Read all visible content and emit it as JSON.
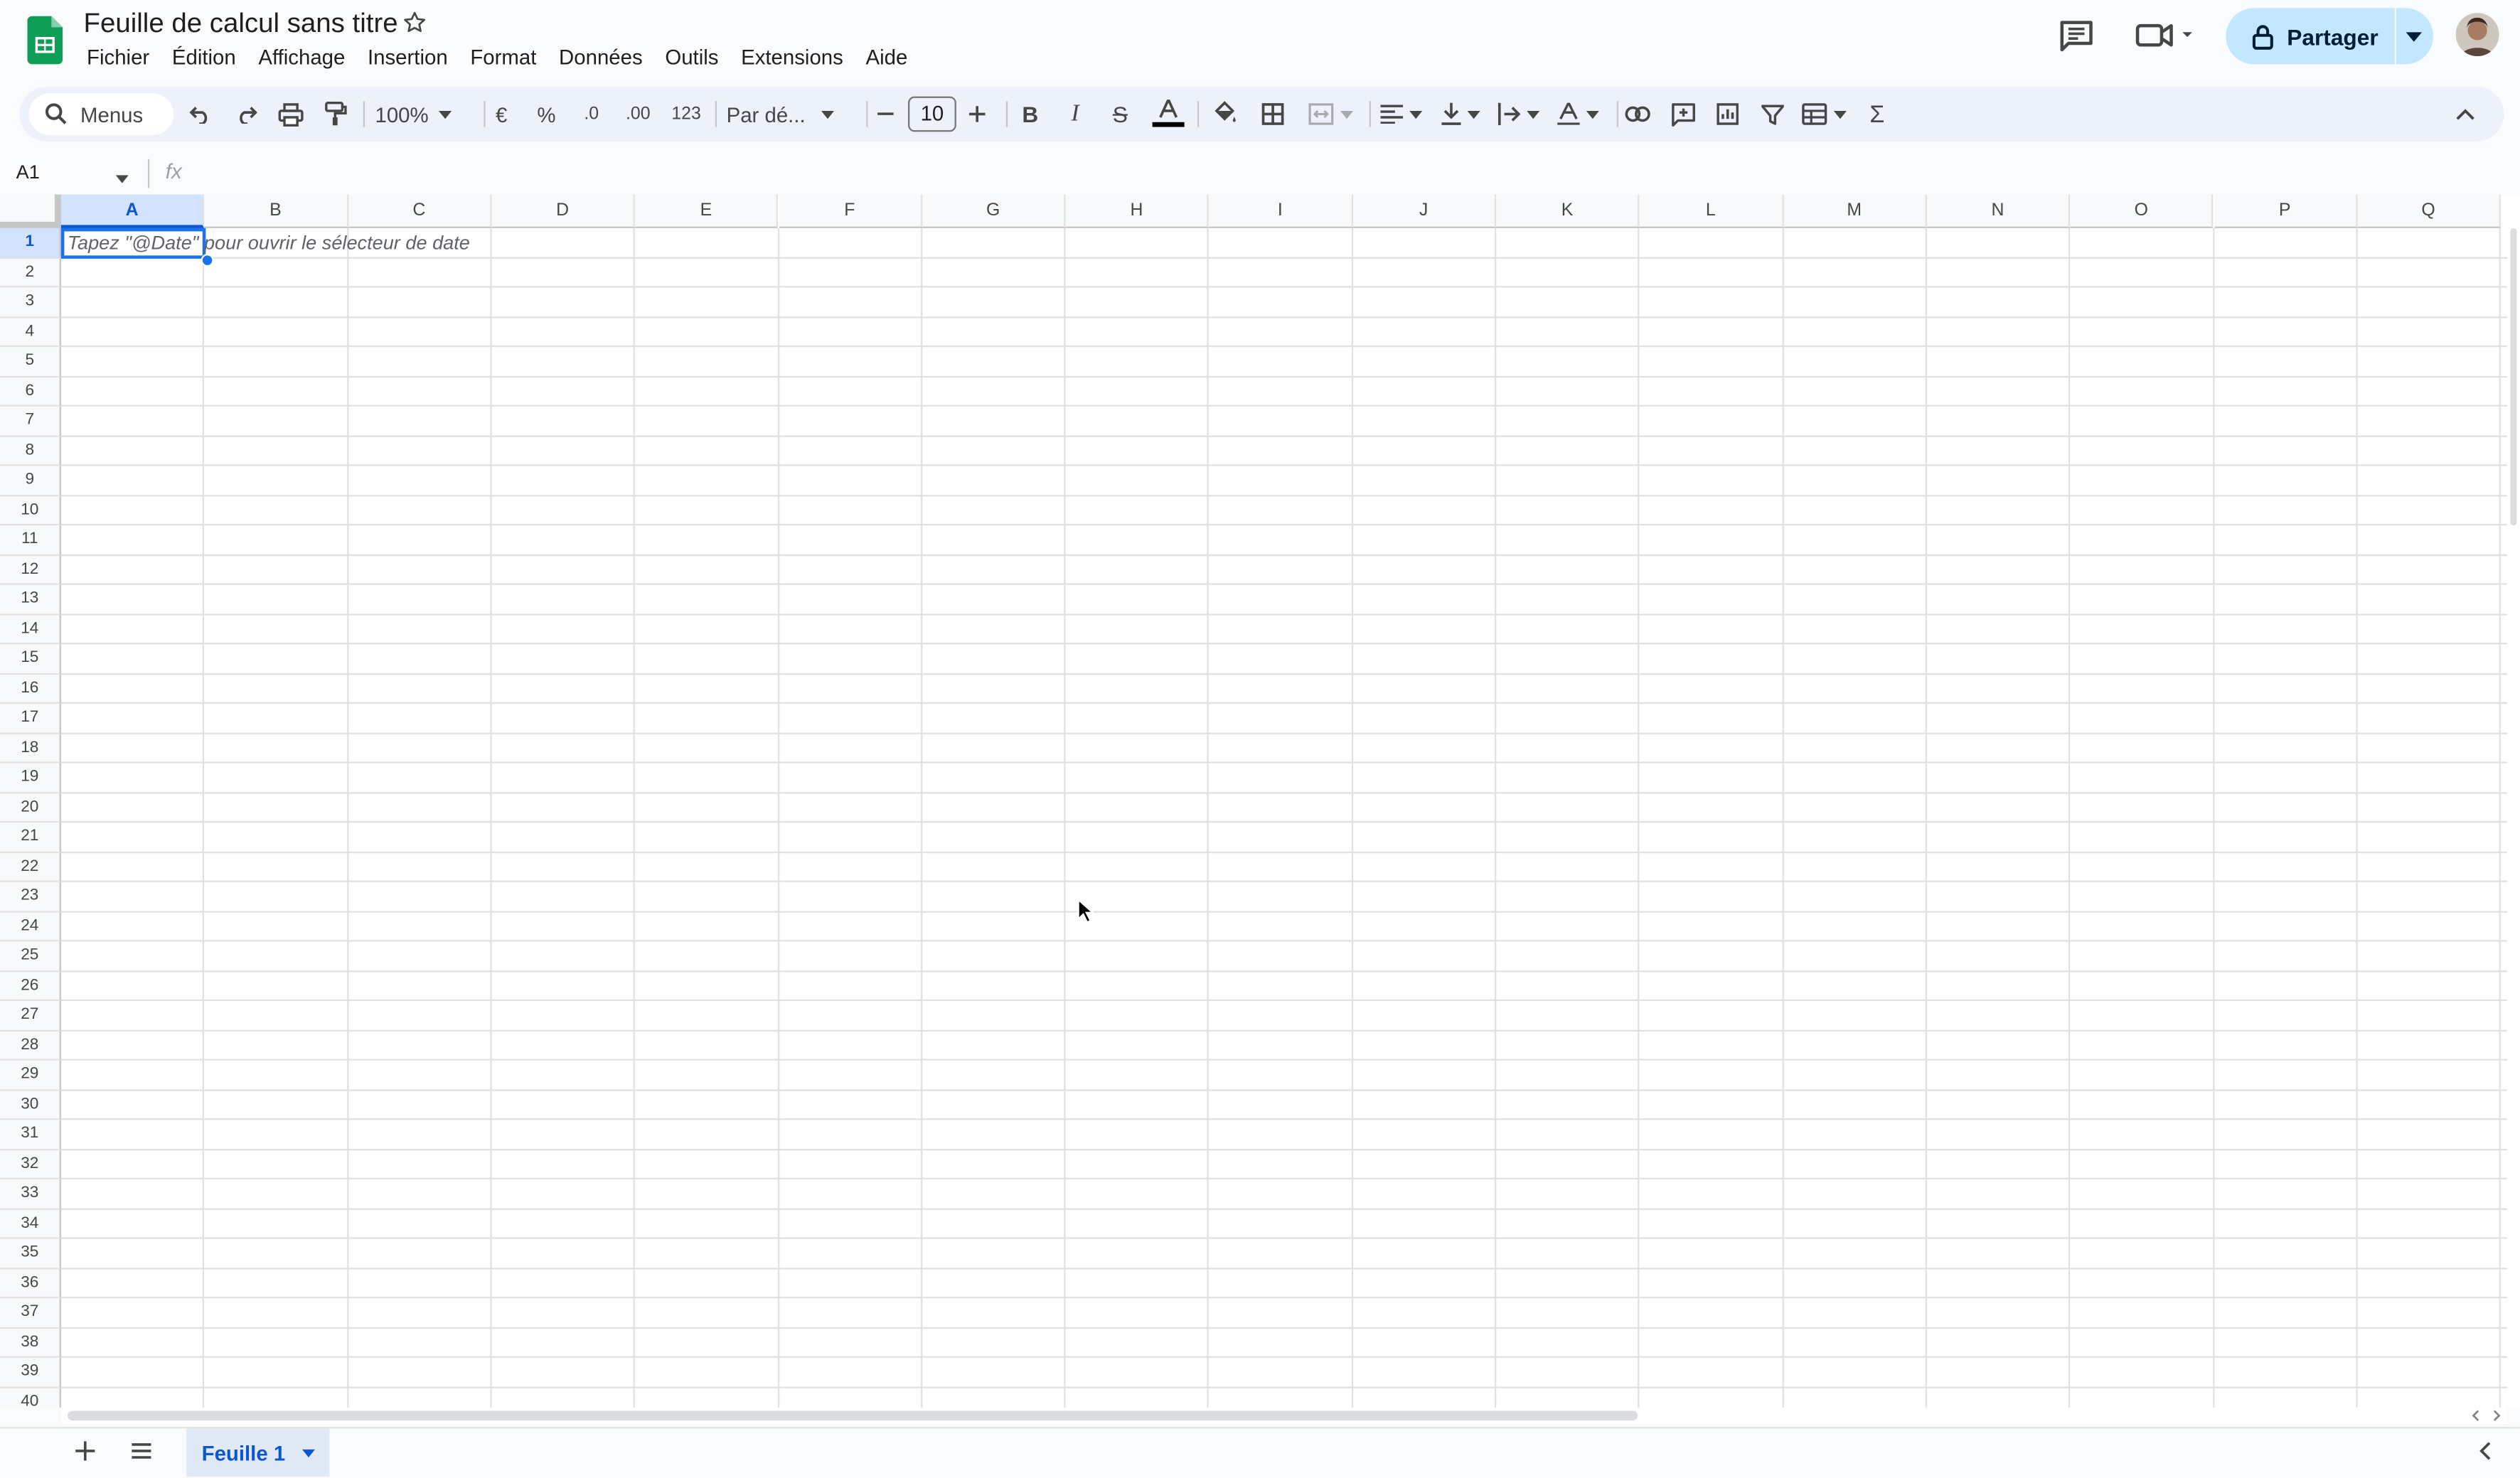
{
  "app": {
    "title": "Feuille de calcul sans titre",
    "menus": [
      "Fichier",
      "Édition",
      "Affichage",
      "Insertion",
      "Format",
      "Données",
      "Outils",
      "Extensions",
      "Aide"
    ],
    "share_label": "Partager",
    "brand_color": "#0f9d58",
    "accent_color": "#1a73e8",
    "share_bg": "#c2e7ff"
  },
  "toolbar": {
    "search_label": "Menus",
    "zoom": "100%",
    "currency": "€",
    "percent": "%",
    "dec_decrease": ".0",
    "dec_increase": ".00",
    "number_format": "123",
    "font": "Par dé...",
    "font_size": "10",
    "icons": [
      "undo-icon",
      "redo-icon",
      "print-icon",
      "paint-format-icon",
      "bold-icon",
      "italic-icon",
      "strikethrough-icon",
      "text-color-icon",
      "fill-color-icon",
      "borders-icon",
      "merge-cells-icon",
      "align-left-icon",
      "valign-bottom-icon",
      "text-wrap-icon",
      "text-rotation-icon",
      "link-icon",
      "comment-icon",
      "chart-icon",
      "filter-icon",
      "table-icon",
      "functions-icon",
      "collapse-icon"
    ]
  },
  "formula_bar": {
    "name_box": "A1",
    "fx": "fx",
    "value": ""
  },
  "grid": {
    "columns": [
      "A",
      "B",
      "C",
      "D",
      "E",
      "F",
      "G",
      "H",
      "I",
      "J",
      "K",
      "L",
      "M",
      "N",
      "O",
      "P",
      "Q"
    ],
    "rows": [
      "1",
      "2",
      "3",
      "4",
      "5",
      "6",
      "7",
      "8",
      "9",
      "10",
      "11",
      "12",
      "13",
      "14",
      "15",
      "16",
      "17",
      "18",
      "19",
      "20",
      "21",
      "22",
      "23",
      "24",
      "25",
      "26",
      "27",
      "28",
      "29",
      "30",
      "31",
      "32",
      "33",
      "34",
      "35",
      "36",
      "37",
      "38",
      "39",
      "40"
    ],
    "selected_cell": "A1",
    "a1_hint": "Tapez \"@Date\" pour ouvrir le sélecteur de date"
  },
  "sheets": {
    "active": "Feuille 1"
  }
}
